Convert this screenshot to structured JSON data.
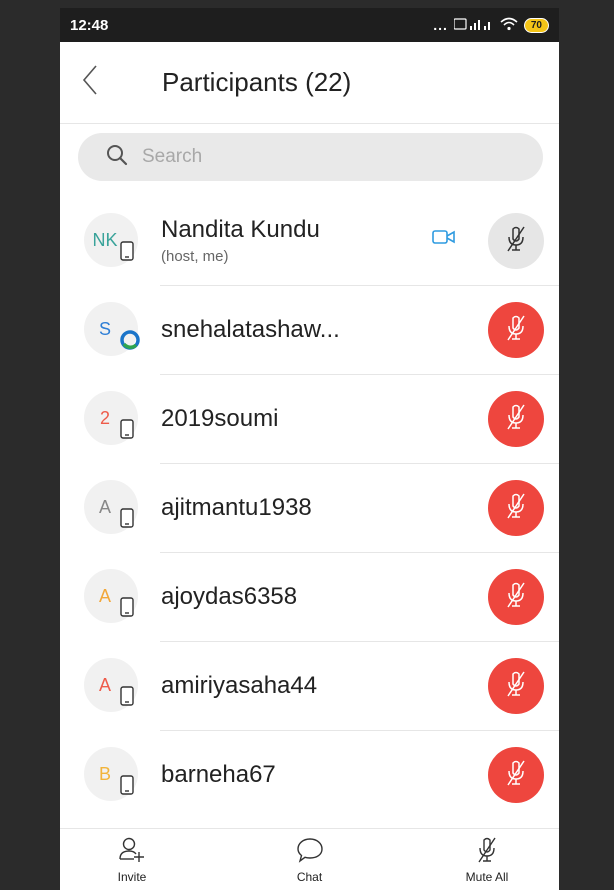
{
  "status_bar": {
    "time": "12:48",
    "signal_text": "...",
    "battery": "70"
  },
  "header": {
    "title": "Participants (22)"
  },
  "search": {
    "placeholder": "Search"
  },
  "participants": [
    {
      "initials": "NK",
      "initials_color": "#3aa39a",
      "name": "Nandita Kundu",
      "subtitle": "(host, me)",
      "mic": "on",
      "has_video": true
    },
    {
      "initials": "S",
      "initials_color": "#2f7fd6",
      "name": "snehalatashaw...",
      "subtitle": "",
      "mic": "muted",
      "has_video": false
    },
    {
      "initials": "2",
      "initials_color": "#ee5b4a",
      "name": "2019soumi",
      "subtitle": "",
      "mic": "muted",
      "has_video": false
    },
    {
      "initials": "A",
      "initials_color": "#888888",
      "name": "ajitmantu1938",
      "subtitle": "",
      "mic": "muted",
      "has_video": false
    },
    {
      "initials": "A",
      "initials_color": "#f2a73a",
      "name": "ajoydas6358",
      "subtitle": "",
      "mic": "muted",
      "has_video": false
    },
    {
      "initials": "A",
      "initials_color": "#ee5b4a",
      "name": "amiriyasaha44",
      "subtitle": "",
      "mic": "muted",
      "has_video": false
    },
    {
      "initials": "B",
      "initials_color": "#f2b43a",
      "name": "barneha67",
      "subtitle": "",
      "mic": "muted",
      "has_video": false
    }
  ],
  "bottom_bar": {
    "invite_label": "Invite",
    "chat_label": "Chat",
    "mute_all_label": "Mute All"
  },
  "colors": {
    "muted_red": "#ee463e",
    "accent_blue": "#2f9be0"
  },
  "icons": {
    "back": "chevron-left-icon",
    "search": "search-icon",
    "video": "video-camera-icon",
    "mic_off": "mic-off-icon",
    "device": "phone-device-icon",
    "invite": "add-person-icon",
    "chat": "chat-bubble-icon"
  }
}
